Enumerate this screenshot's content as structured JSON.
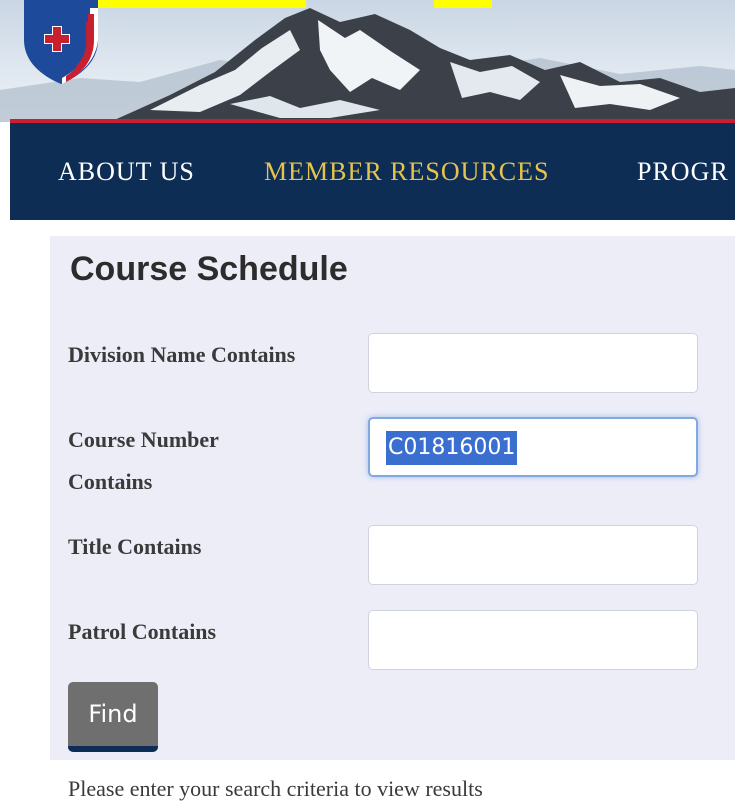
{
  "header": {
    "logo_icon": "national-ski-patrol-shield-logo",
    "highlight_color": "#ffff00"
  },
  "nav": {
    "items": [
      {
        "label": "ABOUT US",
        "active": false
      },
      {
        "label": "MEMBER RESOURCES",
        "active": true
      },
      {
        "label": "PROGR",
        "active": false
      }
    ],
    "background": "#0d2d55",
    "active_color": "#e6c34d"
  },
  "search": {
    "title": "Course Schedule",
    "fields": [
      {
        "label": "Division Name Contains",
        "value": ""
      },
      {
        "label": "Course Number Contains",
        "value": "C01816001"
      },
      {
        "label": "Title Contains",
        "value": ""
      },
      {
        "label": "Patrol Contains",
        "value": ""
      }
    ],
    "find_label": "Find"
  },
  "results": {
    "message": "Please enter your search criteria to view results"
  }
}
